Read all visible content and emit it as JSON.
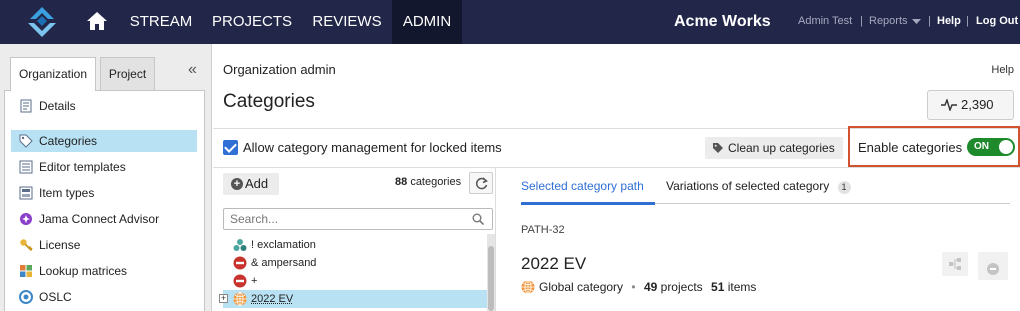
{
  "topnav": {
    "items": [
      "STREAM",
      "PROJECTS",
      "REVIEWS",
      "ADMIN"
    ],
    "active": "ADMIN",
    "brand": "Acme Works",
    "user": "Admin Test",
    "reports": "Reports",
    "help": "Help",
    "logout": "Log Out",
    "separator": "|",
    "colors": {
      "bar": "#22274a",
      "active": "#13172d"
    }
  },
  "sidebar": {
    "tabs": [
      "Organization",
      "Project"
    ],
    "active_tab": "Organization",
    "collapse_glyph": "«",
    "items": [
      {
        "label": "Details",
        "icon": "details-icon"
      },
      {
        "label": "Categories",
        "icon": "tag-icon",
        "active": true
      },
      {
        "label": "Editor templates",
        "icon": "template-icon"
      },
      {
        "label": "Item types",
        "icon": "item-types-icon"
      },
      {
        "label": "Jama Connect Advisor",
        "icon": "advisor-icon"
      },
      {
        "label": "License",
        "icon": "key-icon"
      },
      {
        "label": "Lookup matrices",
        "icon": "matrix-icon"
      },
      {
        "label": "OSLC",
        "icon": "oslc-icon"
      }
    ]
  },
  "main": {
    "breadcrumb": "Organization admin",
    "help": "Help",
    "title": "Categories",
    "activity_count": "2,390",
    "lock_label": "Allow category management for locked items",
    "lock_checked": true,
    "cleanup_label": "Clean up categories",
    "enable_label": "Enable categories",
    "toggle_label": "ON",
    "toggle_on": true,
    "colors": {
      "accent": "#2f6fd6",
      "toggle": "#1e8a2c",
      "highlight": "#d1522f",
      "selection": "#b8e2f3"
    }
  },
  "tree": {
    "add_label": "Add",
    "count": "88",
    "count_suffix": "categories",
    "search_placeholder": "Search...",
    "rows": [
      {
        "label": "! exclamation",
        "icon": "group-icon"
      },
      {
        "label": "& ampersand",
        "icon": "minus-circle-icon"
      },
      {
        "label": "+",
        "icon": "minus-circle-icon"
      },
      {
        "label": "2022 EV",
        "icon": "globe-icon",
        "selected": true,
        "expander": "+"
      }
    ]
  },
  "detail": {
    "tabs": [
      "Selected category path",
      "Variations of selected category"
    ],
    "variations_count": "1",
    "path_id": "PATH-32",
    "category_name": "2022 EV",
    "scope": "Global category",
    "bullet": "•",
    "projects_count": "49",
    "projects_label": "projects",
    "items_count": "51",
    "items_label": "items"
  }
}
